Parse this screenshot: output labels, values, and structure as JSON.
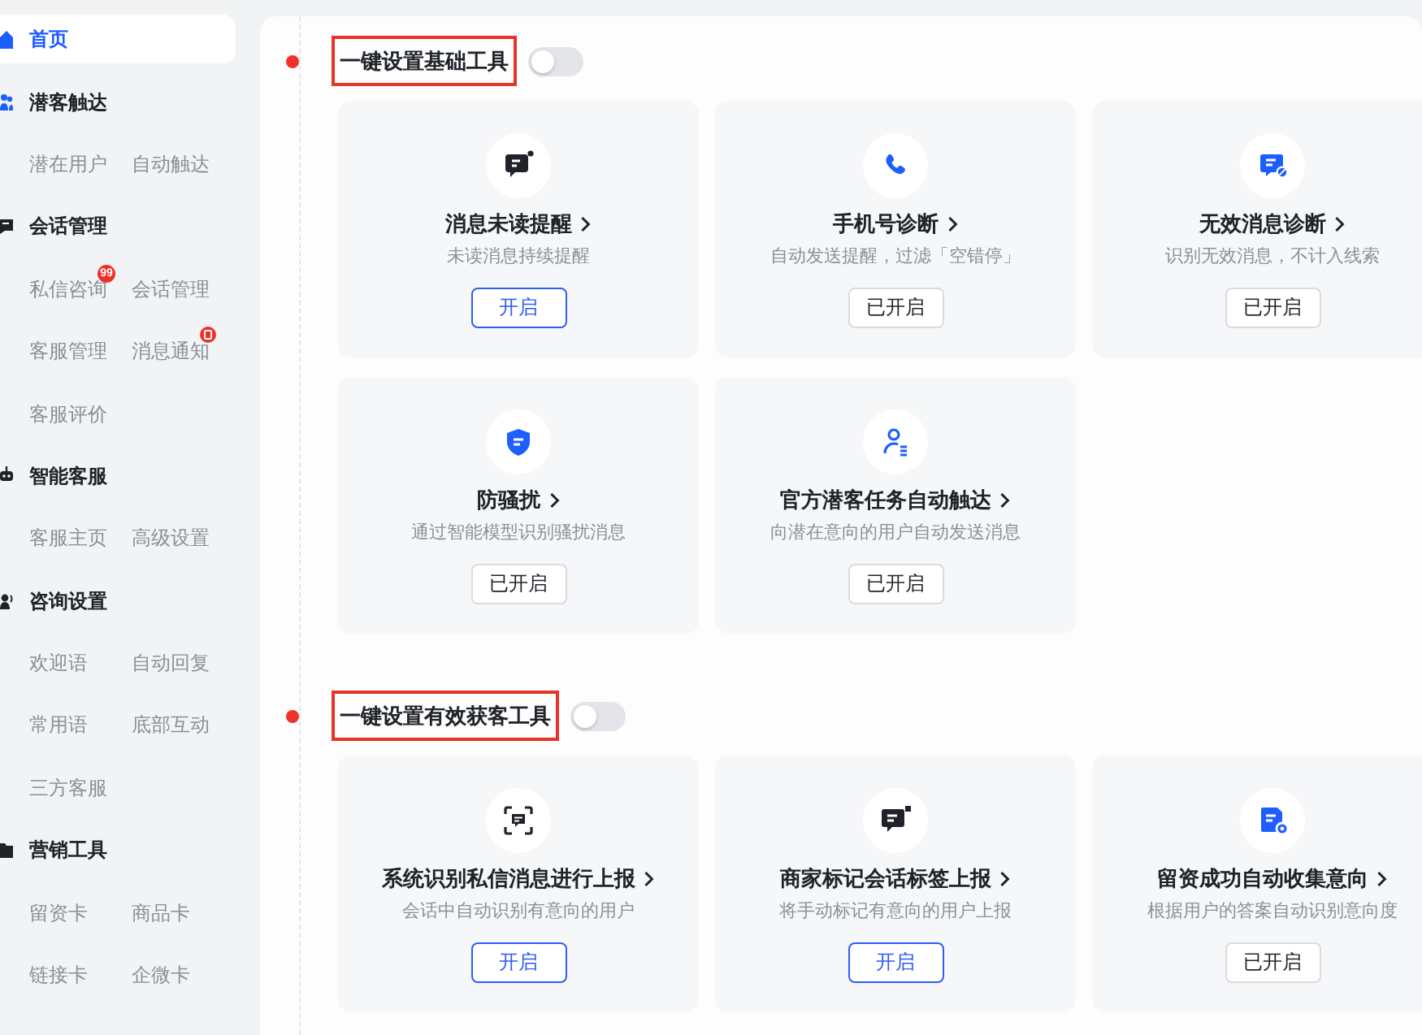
{
  "sidebar": {
    "items": [
      {
        "label": "首页",
        "selected": true
      },
      {
        "label": "潜客触达",
        "selected": false,
        "children": [
          {
            "label": "潜在用户",
            "selected": false,
            "alert": false
          },
          {
            "label": "自动触达",
            "selected": false,
            "alert": false
          }
        ]
      },
      {
        "label": "会话管理",
        "selected": false,
        "children": [
          {
            "label": "私信咨询",
            "selected": false,
            "alert": false,
            "badge": "99"
          },
          {
            "label": "会话管理",
            "selected": false,
            "alert": false
          },
          {
            "label": "客服管理",
            "selected": false,
            "alert": false
          },
          {
            "label": "消息通知",
            "selected": false,
            "alert": true
          },
          {
            "label": "客服评价",
            "selected": false,
            "alert": false
          }
        ]
      },
      {
        "label": "智能客服",
        "selected": false,
        "children": [
          {
            "label": "客服主页",
            "selected": false,
            "alert": false
          },
          {
            "label": "高级设置",
            "selected": false,
            "alert": false
          }
        ]
      },
      {
        "label": "咨询设置",
        "selected": false,
        "children": [
          {
            "label": "欢迎语",
            "selected": false,
            "alert": false
          },
          {
            "label": "自动回复",
            "selected": false,
            "alert": false
          },
          {
            "label": "常用语",
            "selected": false,
            "alert": false
          },
          {
            "label": "底部互动",
            "selected": false,
            "alert": false
          },
          {
            "label": "三方客服",
            "selected": false,
            "alert": false
          }
        ]
      },
      {
        "label": "营销工具",
        "selected": false,
        "children": [
          {
            "label": "留资卡",
            "selected": false,
            "alert": false
          },
          {
            "label": "商品卡",
            "selected": false,
            "alert": false
          },
          {
            "label": "链接卡",
            "selected": false,
            "alert": false
          },
          {
            "label": "企微卡",
            "selected": false,
            "alert": false
          }
        ]
      }
    ]
  },
  "sections": [
    {
      "title": "一键设置基础工具",
      "toggle_on": false,
      "tools": [
        {
          "title": "消息未读提醒",
          "description": "未读消息持续提醒",
          "button": {
            "label": "开启",
            "enabled": false
          }
        },
        {
          "title": "手机号诊断",
          "description": "自动发送提醒，过滤「空错停」",
          "button": {
            "label": "已开启",
            "enabled": true
          }
        },
        {
          "title": "无效消息诊断",
          "description": "识别无效消息，不计入线索",
          "button": {
            "label": "已开启",
            "enabled": true
          }
        },
        {
          "title": "防骚扰",
          "description": "通过智能模型识别骚扰消息",
          "button": {
            "label": "已开启",
            "enabled": true
          }
        },
        {
          "title": "官方潜客任务自动触达",
          "description": "向潜在意向的用户自动发送消息",
          "button": {
            "label": "已开启",
            "enabled": true
          }
        }
      ]
    },
    {
      "title": "一键设置有效获客工具",
      "toggle_on": false,
      "tools": [
        {
          "title": "系统识别私信消息进行上报",
          "description": "会话中自动识别有意向的用户",
          "button": {
            "label": "开启",
            "enabled": false
          }
        },
        {
          "title": "商家标记会话标签上报",
          "description": "将手动标记有意向的用户上报",
          "button": {
            "label": "开启",
            "enabled": false
          }
        },
        {
          "title": "留资成功自动收集意向",
          "description": "根据用户的答案自动识别意向度",
          "button": {
            "label": "已开启",
            "enabled": true
          }
        }
      ]
    }
  ]
}
